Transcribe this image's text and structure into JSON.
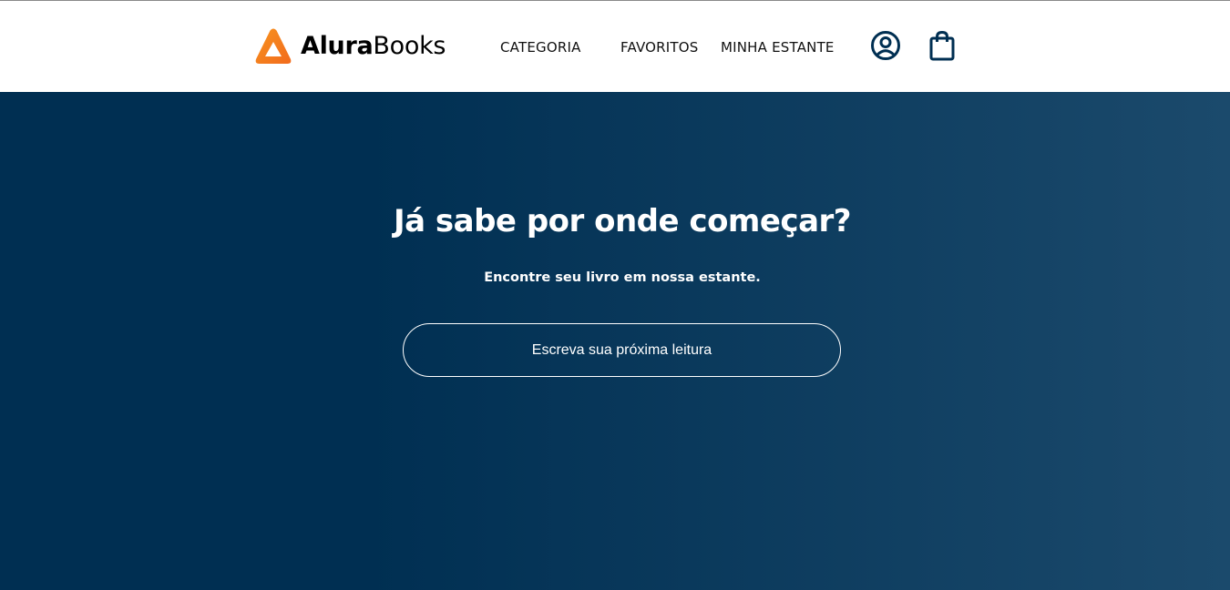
{
  "brand": {
    "name_bold": "Alura",
    "name_regular": "Books",
    "logo_icon": "triangle-logo-icon",
    "accent_color": "#F58220"
  },
  "nav": {
    "items": [
      {
        "label": "CATEGORIA"
      },
      {
        "label": "FAVORITOS"
      },
      {
        "label": "MINHA ESTANTE"
      }
    ],
    "user_icon": "user-circle-icon",
    "bag_icon": "shopping-bag-icon"
  },
  "hero": {
    "title": "Já sabe por onde começar?",
    "subtitle": "Encontre seu livro em nossa estante.",
    "search_placeholder": "Escreva sua próxima leitura",
    "search_value": "",
    "background_color": "#002F52"
  }
}
